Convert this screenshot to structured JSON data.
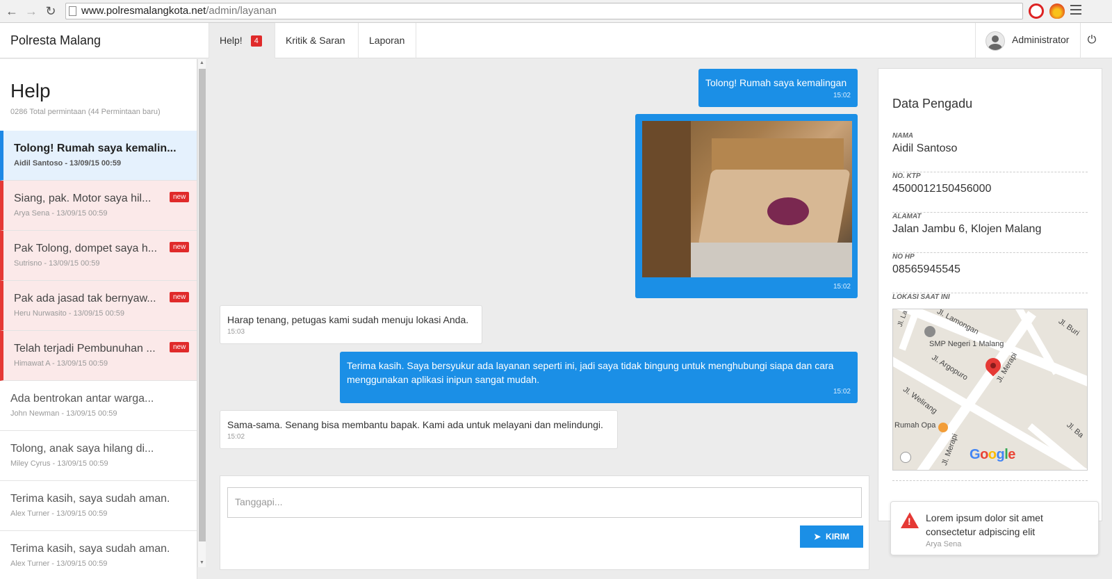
{
  "browser": {
    "url_host": "www.polresmalangkota.net",
    "url_path": "/admin/layanan"
  },
  "nav": {
    "brand": "Polresta Malang",
    "tabs": [
      {
        "label": "Help!",
        "badge": "4"
      },
      {
        "label": "Kritik & Saran"
      },
      {
        "label": "Laporan"
      }
    ],
    "user": "Administrator"
  },
  "sidebar": {
    "title": "Help",
    "subtitle": "0286 Total permintaan (44 Permintaan baru)",
    "new_label": "new",
    "threads": [
      {
        "title": "Tolong! Rumah saya kemalin...",
        "meta": "Aidil Santoso - 13/09/15 00:59",
        "state": "active"
      },
      {
        "title": "Siang, pak. Motor saya hil...",
        "meta": "Arya Sena - 13/09/15 00:59",
        "state": "unread"
      },
      {
        "title": "Pak Tolong, dompet saya h...",
        "meta": "Sutrisno - 13/09/15 00:59",
        "state": "unread"
      },
      {
        "title": "Pak ada jasad tak bernyaw...",
        "meta": "Heru Nurwasito - 13/09/15 00:59",
        "state": "unread"
      },
      {
        "title": "Telah terjadi Pembunuhan ...",
        "meta": "Himawat A - 13/09/15 00:59",
        "state": "unread"
      },
      {
        "title": "Ada bentrokan antar warga...",
        "meta": "John Newman - 13/09/15 00:59",
        "state": "read"
      },
      {
        "title": "Tolong, anak saya hilang di...",
        "meta": "Miley Cyrus - 13/09/15 00:59",
        "state": "read"
      },
      {
        "title": "Terima kasih, saya sudah aman.",
        "meta": "Alex Turner - 13/09/15 00:59",
        "state": "read"
      },
      {
        "title": "Terima kasih, saya sudah aman.",
        "meta": "Alex Turner - 13/09/15 00:59",
        "state": "read"
      }
    ]
  },
  "chat": {
    "messages": [
      {
        "direction": "out",
        "type": "text",
        "text": "Tolong! Rumah saya kemalingan",
        "time": "15:02"
      },
      {
        "direction": "out",
        "type": "image",
        "time": "15:02"
      },
      {
        "direction": "in",
        "type": "text",
        "text": "Harap tenang, petugas kami sudah menuju lokasi Anda.",
        "time": "15:03"
      },
      {
        "direction": "out",
        "type": "text",
        "text": "Terima kasih. Saya bersyukur ada layanan seperti ini, jadi saya tidak bingung untuk menghubungi siapa dan cara menggunakan aplikasi inipun sangat mudah.",
        "time": "15:02"
      },
      {
        "direction": "in",
        "type": "text",
        "text": "Sama-sama. Senang bisa membantu bapak. Kami ada untuk melayani dan melindungi.",
        "time": "15:02"
      }
    ],
    "reply_placeholder": "Tanggapi...",
    "send_label": "KIRIM"
  },
  "detail": {
    "title": "Data Pengadu",
    "fields": [
      {
        "label": "NAMA",
        "value": "Aidil Santoso"
      },
      {
        "label": "NO. KTP",
        "value": "4500012150456000"
      },
      {
        "label": "ALAMAT",
        "value": "Jalan Jambu 6, Klojen Malang"
      },
      {
        "label": "NO HP",
        "value": "08565945545"
      }
    ],
    "location_label": "LOKASI SAAT INI",
    "map_labels": {
      "school": "SMP Negeri 1 Malang",
      "cafe": "Rumah Opa",
      "street_1": "Jl. Lamongan",
      "street_2": "Jl. Argopuro",
      "street_3": "Jl. Merapi",
      "street_4": "Jl. Welirang",
      "street_5": "Jl. Buri",
      "street_6": "Jl. Ba",
      "street_7": "Jl. La",
      "street_8": "Jl. Merapi",
      "google": "Google"
    }
  },
  "toast": {
    "message": "Lorem ipsum dolor sit amet consectetur adpiscing elit",
    "sender": "Arya Sena"
  },
  "colors": {
    "accent": "#1b8fe6",
    "danger": "#e02a2a",
    "active_bg": "#e5f1fd",
    "unread_bg": "#fbe9e9"
  }
}
